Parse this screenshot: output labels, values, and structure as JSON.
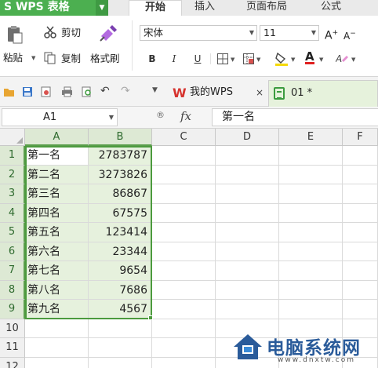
{
  "app": {
    "title": "S WPS 表格",
    "menu_arrow": "▼"
  },
  "ribbon_tabs": [
    {
      "label": "开始",
      "active": true
    },
    {
      "label": "插入",
      "active": false
    },
    {
      "label": "页面布局",
      "active": false
    },
    {
      "label": "公式",
      "active": false
    }
  ],
  "ribbon": {
    "paste_label": "粘贴",
    "cut_label": "剪切",
    "copy_label": "复制",
    "format_painter_label": "格式刷",
    "font_name": "宋体",
    "font_size": "11",
    "grow_font": "A",
    "shrink_font": "A",
    "bold": "B",
    "italic": "I",
    "underline": "U",
    "font_color_letter": "A",
    "colors": {
      "fill_highlight": "#f5d90a",
      "font_color": "#e02020",
      "accent_green": "#4caf50"
    }
  },
  "doc_tabs": [
    {
      "label": "我的WPS",
      "close": "×"
    },
    {
      "label": "01 *"
    }
  ],
  "formula_bar": {
    "name_box": "A1",
    "fx": "fx",
    "zoom_icon_text": "®",
    "content": "第一名"
  },
  "columns": [
    "A",
    "B",
    "C",
    "D",
    "E",
    "F"
  ],
  "rows": [
    {
      "num": "1",
      "a": "第一名",
      "b": "2783787"
    },
    {
      "num": "2",
      "a": "第二名",
      "b": "3273826"
    },
    {
      "num": "3",
      "a": "第三名",
      "b": "86867"
    },
    {
      "num": "4",
      "a": "第四名",
      "b": "67575"
    },
    {
      "num": "5",
      "a": "第五名",
      "b": "123414"
    },
    {
      "num": "6",
      "a": "第六名",
      "b": "23344"
    },
    {
      "num": "7",
      "a": "第七名",
      "b": "9654"
    },
    {
      "num": "8",
      "a": "第八名",
      "b": "7686"
    },
    {
      "num": "9",
      "a": "第九名",
      "b": "4567"
    },
    {
      "num": "10",
      "a": "",
      "b": ""
    },
    {
      "num": "11",
      "a": "",
      "b": ""
    },
    {
      "num": "12",
      "a": "",
      "b": ""
    }
  ],
  "watermark": {
    "title": "电脑系统网",
    "url": "www.dnxtw.com"
  }
}
